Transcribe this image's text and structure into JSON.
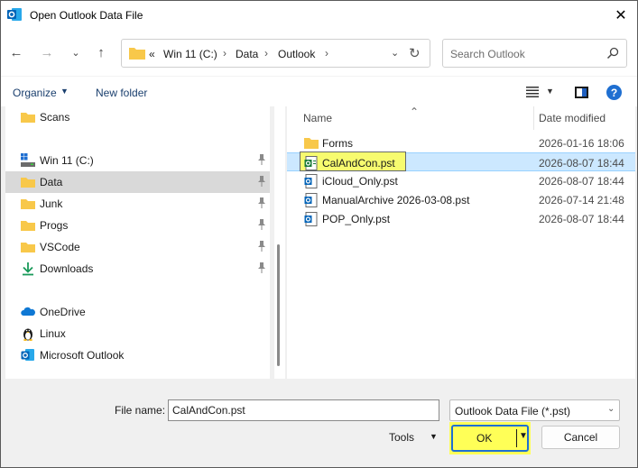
{
  "window": {
    "title": "Open Outlook Data File"
  },
  "nav": {
    "crumbs": [
      "«",
      "Win 11 (C:)",
      "Data",
      "Outlook"
    ],
    "search_placeholder": "Search Outlook"
  },
  "toolbar": {
    "organize_label": "Organize",
    "new_folder_label": "New folder"
  },
  "sidebar": {
    "items": [
      {
        "label": "Scans",
        "icon": "folder-icon"
      },
      {
        "label": "Win 11 (C:)",
        "icon": "drive-icon"
      },
      {
        "label": "Data",
        "icon": "folder-icon"
      },
      {
        "label": "Junk",
        "icon": "folder-icon"
      },
      {
        "label": "Progs",
        "icon": "folder-icon"
      },
      {
        "label": "VSCode",
        "icon": "folder-icon"
      },
      {
        "label": "Downloads",
        "icon": "download-icon"
      },
      {
        "label": "OneDrive",
        "icon": "cloud-icon"
      },
      {
        "label": "Linux",
        "icon": "penguin-icon"
      },
      {
        "label": "Microsoft Outlook",
        "icon": "outlook-icon"
      }
    ]
  },
  "filelist": {
    "columns": {
      "name": "Name",
      "date": "Date modified"
    },
    "files": [
      {
        "name": "Forms",
        "date": "2026-01-16 18:06",
        "type": "folder"
      },
      {
        "name": "CalAndCon.pst",
        "date": "2026-08-07 18:44",
        "type": "pst"
      },
      {
        "name": "iCloud_Only.pst",
        "date": "2026-08-07 18:44",
        "type": "pst"
      },
      {
        "name": "ManualArchive 2026-03-08.pst",
        "date": "2026-07-14 21:48",
        "type": "pst"
      },
      {
        "name": "POP_Only.pst",
        "date": "2026-08-07 18:44",
        "type": "pst"
      }
    ]
  },
  "footer": {
    "filename_label": "File name:",
    "filename_value": "CalAndCon.pst",
    "filter_value": "Outlook Data File (*.pst)",
    "tools_label": "Tools",
    "ok_label": "OK",
    "cancel_label": "Cancel"
  },
  "colors": {
    "accent": "#1f6fd1",
    "selection": "#cce8ff",
    "highlight": "#ffff57",
    "folder": "#f8c84a"
  }
}
